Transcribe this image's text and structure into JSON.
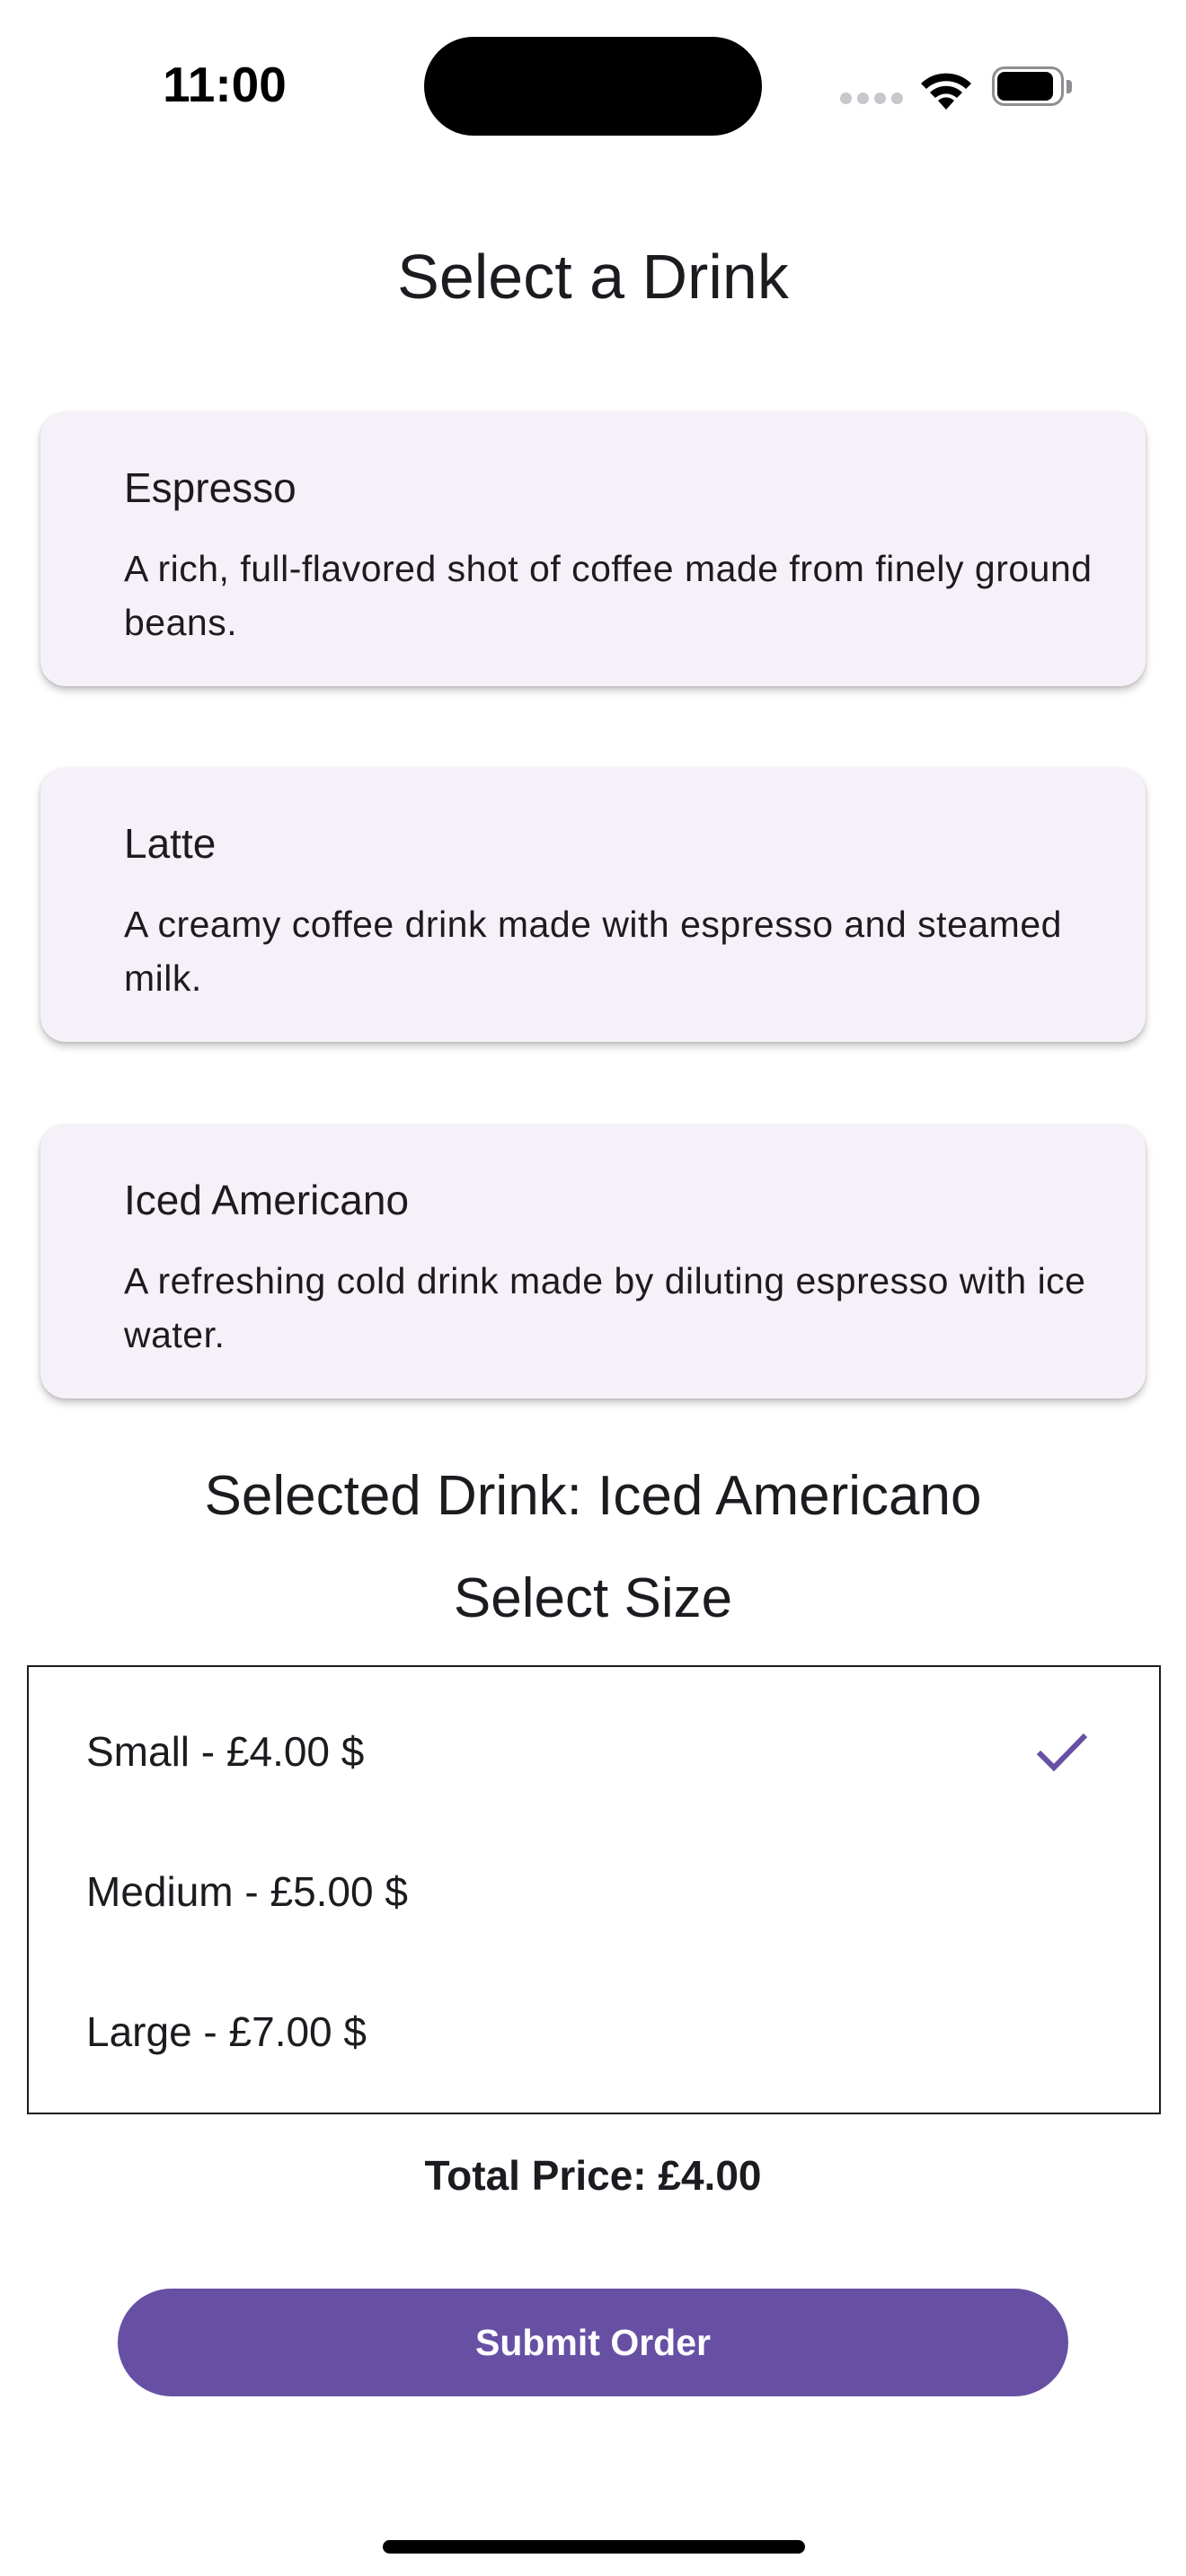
{
  "status_bar": {
    "time": "11:00",
    "icons": [
      "cell-signal-icon",
      "wifi-icon",
      "battery-icon"
    ]
  },
  "page": {
    "title": "Select a Drink"
  },
  "drinks": [
    {
      "name": "Espresso",
      "description": "A rich, full-flavored shot of coffee made from finely ground beans."
    },
    {
      "name": "Latte",
      "description": "A creamy coffee drink made with espresso and steamed milk."
    },
    {
      "name": "Iced Americano",
      "description": "A refreshing cold drink made by diluting espresso with ice water."
    }
  ],
  "selection": {
    "selected_drink": "Selected Drink: Iced Americano",
    "size_title": "Select Size",
    "sizes": [
      {
        "label": "Small - £4.00 $",
        "selected": true
      },
      {
        "label": "Medium - £5.00 $",
        "selected": false
      },
      {
        "label": "Large - £7.00 $",
        "selected": false
      }
    ]
  },
  "order": {
    "total_price": "Total Price: £4.00",
    "submit_label": "Submit Order"
  },
  "colors": {
    "primary": "#6750a4",
    "card_background": "#f6f1f8",
    "text": "#1d1b20"
  }
}
